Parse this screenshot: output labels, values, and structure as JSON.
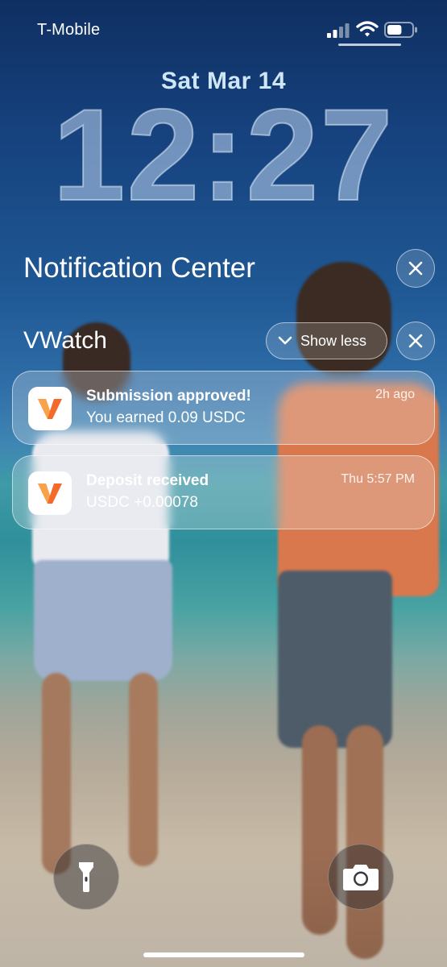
{
  "status_bar": {
    "carrier": "T-Mobile",
    "icons": [
      "signal-icon",
      "wifi-icon",
      "battery-icon"
    ],
    "battery_level": 0.6
  },
  "lock_screen": {
    "date": "Sat Mar 14",
    "time": "12:27"
  },
  "notification_center": {
    "title": "Notification Center",
    "close_icon": "close-icon"
  },
  "app_group": {
    "app_name": "VWatch",
    "show_less_label": "Show less",
    "notifications": [
      {
        "title": "Submission approved!",
        "body": "You earned 0.09 USDC",
        "time": "2h ago"
      },
      {
        "title": "Deposit received",
        "body": "USDC +0.00078",
        "time": "Thu 5:57 PM"
      }
    ]
  },
  "quick_actions": {
    "left": "flashlight-icon",
    "right": "camera-icon"
  },
  "colors": {
    "app_icon_orange": "#F36A2B",
    "app_icon_orange_light": "#F8A24A",
    "app_icon_bg": "#FFFFFF"
  }
}
